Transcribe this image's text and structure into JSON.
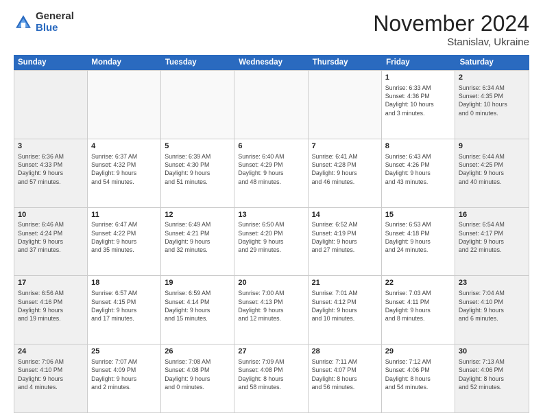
{
  "logo": {
    "general": "General",
    "blue": "Blue"
  },
  "title": "November 2024",
  "location": "Stanislav, Ukraine",
  "weekdays": [
    "Sunday",
    "Monday",
    "Tuesday",
    "Wednesday",
    "Thursday",
    "Friday",
    "Saturday"
  ],
  "weeks": [
    [
      {
        "day": "",
        "info": "",
        "type": "empty"
      },
      {
        "day": "",
        "info": "",
        "type": "empty"
      },
      {
        "day": "",
        "info": "",
        "type": "empty"
      },
      {
        "day": "",
        "info": "",
        "type": "empty"
      },
      {
        "day": "",
        "info": "",
        "type": "empty"
      },
      {
        "day": "1",
        "info": "Sunrise: 6:33 AM\nSunset: 4:36 PM\nDaylight: 10 hours\nand 3 minutes.",
        "type": "fri"
      },
      {
        "day": "2",
        "info": "Sunrise: 6:34 AM\nSunset: 4:35 PM\nDaylight: 10 hours\nand 0 minutes.",
        "type": "sat"
      }
    ],
    [
      {
        "day": "3",
        "info": "Sunrise: 6:36 AM\nSunset: 4:33 PM\nDaylight: 9 hours\nand 57 minutes.",
        "type": "sun"
      },
      {
        "day": "4",
        "info": "Sunrise: 6:37 AM\nSunset: 4:32 PM\nDaylight: 9 hours\nand 54 minutes.",
        "type": ""
      },
      {
        "day": "5",
        "info": "Sunrise: 6:39 AM\nSunset: 4:30 PM\nDaylight: 9 hours\nand 51 minutes.",
        "type": ""
      },
      {
        "day": "6",
        "info": "Sunrise: 6:40 AM\nSunset: 4:29 PM\nDaylight: 9 hours\nand 48 minutes.",
        "type": ""
      },
      {
        "day": "7",
        "info": "Sunrise: 6:41 AM\nSunset: 4:28 PM\nDaylight: 9 hours\nand 46 minutes.",
        "type": ""
      },
      {
        "day": "8",
        "info": "Sunrise: 6:43 AM\nSunset: 4:26 PM\nDaylight: 9 hours\nand 43 minutes.",
        "type": ""
      },
      {
        "day": "9",
        "info": "Sunrise: 6:44 AM\nSunset: 4:25 PM\nDaylight: 9 hours\nand 40 minutes.",
        "type": "sat"
      }
    ],
    [
      {
        "day": "10",
        "info": "Sunrise: 6:46 AM\nSunset: 4:24 PM\nDaylight: 9 hours\nand 37 minutes.",
        "type": "sun"
      },
      {
        "day": "11",
        "info": "Sunrise: 6:47 AM\nSunset: 4:22 PM\nDaylight: 9 hours\nand 35 minutes.",
        "type": ""
      },
      {
        "day": "12",
        "info": "Sunrise: 6:49 AM\nSunset: 4:21 PM\nDaylight: 9 hours\nand 32 minutes.",
        "type": ""
      },
      {
        "day": "13",
        "info": "Sunrise: 6:50 AM\nSunset: 4:20 PM\nDaylight: 9 hours\nand 29 minutes.",
        "type": ""
      },
      {
        "day": "14",
        "info": "Sunrise: 6:52 AM\nSunset: 4:19 PM\nDaylight: 9 hours\nand 27 minutes.",
        "type": ""
      },
      {
        "day": "15",
        "info": "Sunrise: 6:53 AM\nSunset: 4:18 PM\nDaylight: 9 hours\nand 24 minutes.",
        "type": ""
      },
      {
        "day": "16",
        "info": "Sunrise: 6:54 AM\nSunset: 4:17 PM\nDaylight: 9 hours\nand 22 minutes.",
        "type": "sat"
      }
    ],
    [
      {
        "day": "17",
        "info": "Sunrise: 6:56 AM\nSunset: 4:16 PM\nDaylight: 9 hours\nand 19 minutes.",
        "type": "sun"
      },
      {
        "day": "18",
        "info": "Sunrise: 6:57 AM\nSunset: 4:15 PM\nDaylight: 9 hours\nand 17 minutes.",
        "type": ""
      },
      {
        "day": "19",
        "info": "Sunrise: 6:59 AM\nSunset: 4:14 PM\nDaylight: 9 hours\nand 15 minutes.",
        "type": ""
      },
      {
        "day": "20",
        "info": "Sunrise: 7:00 AM\nSunset: 4:13 PM\nDaylight: 9 hours\nand 12 minutes.",
        "type": ""
      },
      {
        "day": "21",
        "info": "Sunrise: 7:01 AM\nSunset: 4:12 PM\nDaylight: 9 hours\nand 10 minutes.",
        "type": ""
      },
      {
        "day": "22",
        "info": "Sunrise: 7:03 AM\nSunset: 4:11 PM\nDaylight: 9 hours\nand 8 minutes.",
        "type": ""
      },
      {
        "day": "23",
        "info": "Sunrise: 7:04 AM\nSunset: 4:10 PM\nDaylight: 9 hours\nand 6 minutes.",
        "type": "sat"
      }
    ],
    [
      {
        "day": "24",
        "info": "Sunrise: 7:06 AM\nSunset: 4:10 PM\nDaylight: 9 hours\nand 4 minutes.",
        "type": "sun"
      },
      {
        "day": "25",
        "info": "Sunrise: 7:07 AM\nSunset: 4:09 PM\nDaylight: 9 hours\nand 2 minutes.",
        "type": ""
      },
      {
        "day": "26",
        "info": "Sunrise: 7:08 AM\nSunset: 4:08 PM\nDaylight: 9 hours\nand 0 minutes.",
        "type": ""
      },
      {
        "day": "27",
        "info": "Sunrise: 7:09 AM\nSunset: 4:08 PM\nDaylight: 8 hours\nand 58 minutes.",
        "type": ""
      },
      {
        "day": "28",
        "info": "Sunrise: 7:11 AM\nSunset: 4:07 PM\nDaylight: 8 hours\nand 56 minutes.",
        "type": ""
      },
      {
        "day": "29",
        "info": "Sunrise: 7:12 AM\nSunset: 4:06 PM\nDaylight: 8 hours\nand 54 minutes.",
        "type": ""
      },
      {
        "day": "30",
        "info": "Sunrise: 7:13 AM\nSunset: 4:06 PM\nDaylight: 8 hours\nand 52 minutes.",
        "type": "sat"
      }
    ]
  ]
}
